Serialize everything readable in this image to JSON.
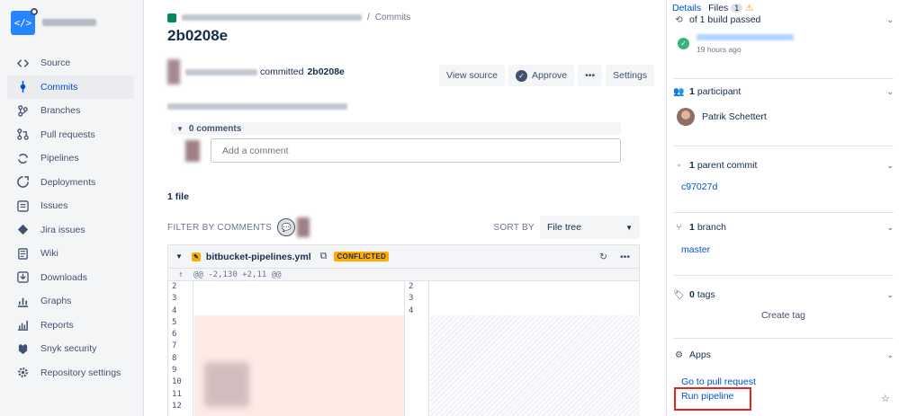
{
  "sidebar": {
    "repo_icon": "</>",
    "items": [
      {
        "label": "Source",
        "icon": "source-icon"
      },
      {
        "label": "Commits",
        "icon": "commits-icon",
        "active": true
      },
      {
        "label": "Branches",
        "icon": "branches-icon"
      },
      {
        "label": "Pull requests",
        "icon": "pull-requests-icon"
      },
      {
        "label": "Pipelines",
        "icon": "pipelines-icon"
      },
      {
        "label": "Deployments",
        "icon": "deployments-icon"
      },
      {
        "label": "Issues",
        "icon": "issues-icon"
      },
      {
        "label": "Jira issues",
        "icon": "jira-icon"
      },
      {
        "label": "Wiki",
        "icon": "wiki-icon"
      },
      {
        "label": "Downloads",
        "icon": "downloads-icon"
      },
      {
        "label": "Graphs",
        "icon": "graphs-icon"
      },
      {
        "label": "Reports",
        "icon": "reports-icon"
      },
      {
        "label": "Snyk security",
        "icon": "snyk-icon"
      },
      {
        "label": "Repository settings",
        "icon": "settings-icon"
      }
    ]
  },
  "main": {
    "breadcrumb_last": "Commits",
    "breadcrumb_sep": "/",
    "title": "2b0208e",
    "commit_text": "committed",
    "commit_hash": "2b0208e",
    "toolbar": {
      "view_source": "View source",
      "approve": "Approve",
      "more": "•••",
      "settings": "Settings"
    },
    "comments_header": "0 comments",
    "comment_placeholder": "Add a comment",
    "file_count": "1 file",
    "filter_label": "FILTER BY COMMENTS",
    "sort_label": "SORT BY",
    "sort_value": "File tree",
    "diff": {
      "filename": "bitbucket-pipelines.yml",
      "badge": "CONFLICTED",
      "hunk": "@@ -2,130 +2,11 @@",
      "left_lines": [
        "2",
        "3",
        "4",
        "5",
        "6",
        "7",
        "8",
        "9",
        "10",
        "11",
        "12"
      ],
      "right_lines": [
        "2",
        "3",
        "4"
      ]
    }
  },
  "panel": {
    "tabs": {
      "details": "Details",
      "files": "Files",
      "files_count": "1"
    },
    "build_head": "of 1 build passed",
    "build_time": "19 hours ago",
    "participants_count": "1",
    "participants_label": "participant",
    "participant_name": "Patrik Schettert",
    "parent_count": "1",
    "parent_label": "parent commit",
    "parent_hash": "c97027d",
    "branch_count": "1",
    "branch_label": "branch",
    "branch_name": "master",
    "tags_count": "0",
    "tags_label": "tags",
    "create_tag": "Create tag",
    "apps_label": "Apps",
    "go_to_pr": "Go to pull request",
    "run_pipeline": "Run pipeline"
  },
  "colors": {
    "accent": "#0052cc",
    "highlight_box": "#e5251c",
    "conflict": "#ffab00",
    "success": "#36b37e"
  }
}
